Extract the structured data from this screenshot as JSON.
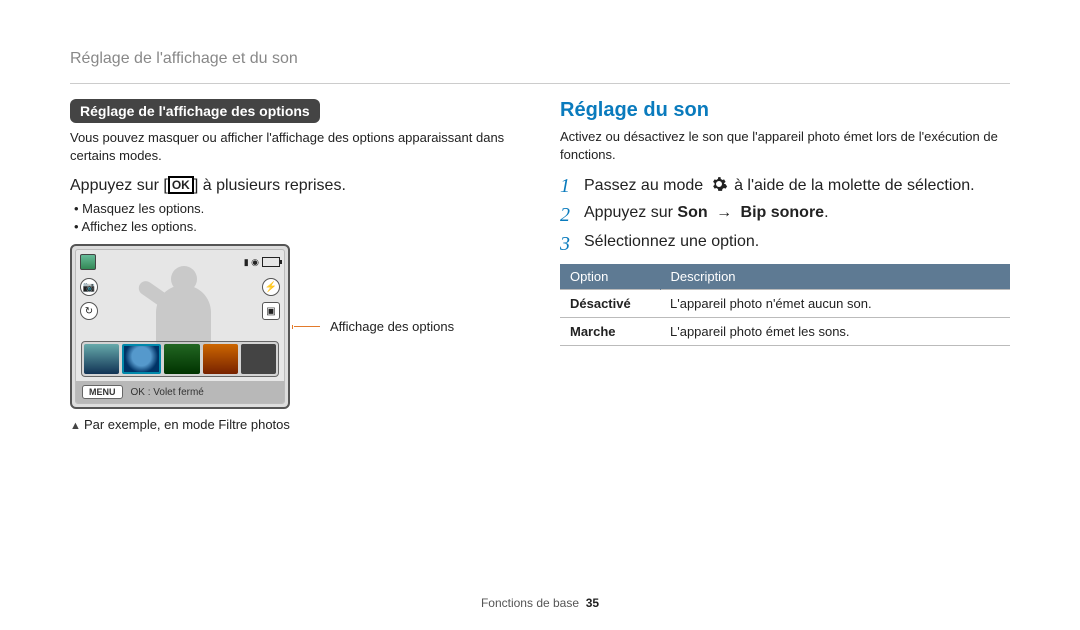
{
  "page_title": "Réglage de l'affichage et du son",
  "left": {
    "section_pill": "Réglage de l'affichage des options",
    "intro": "Vous pouvez masquer ou afficher l'affichage des options apparaissant dans certains modes.",
    "instruction_pre": "Appuyez sur [",
    "instruction_ok": "OK",
    "instruction_post": "] à plusieurs reprises.",
    "bullets": [
      "Masquez les options.",
      "Affichez les options."
    ],
    "lcd": {
      "menu_label": "MENU",
      "ok_label": "OK : Volet fermé"
    },
    "callout": "Affichage des options",
    "caption": "Par exemple, en mode Filtre photos"
  },
  "right": {
    "heading": "Réglage du son",
    "intro": "Activez ou désactivez le son que l'appareil photo émet lors de l'exécution de fonctions.",
    "steps": [
      {
        "pre": "Passez au mode ",
        "post": " à l'aide de la molette de sélection."
      },
      {
        "pre": "Appuyez sur ",
        "bold1": "Son",
        "arrow": "→",
        "bold2": "Bip sonore",
        "post": "."
      },
      {
        "pre": "Sélectionnez une option."
      }
    ],
    "table": {
      "head_option": "Option",
      "head_desc": "Description",
      "rows": [
        {
          "opt": "Désactivé",
          "desc": "L'appareil photo n'émet aucun son."
        },
        {
          "opt": "Marche",
          "desc": "L'appareil photo émet les sons."
        }
      ]
    }
  },
  "footer": {
    "label": "Fonctions de base",
    "page": "35"
  }
}
